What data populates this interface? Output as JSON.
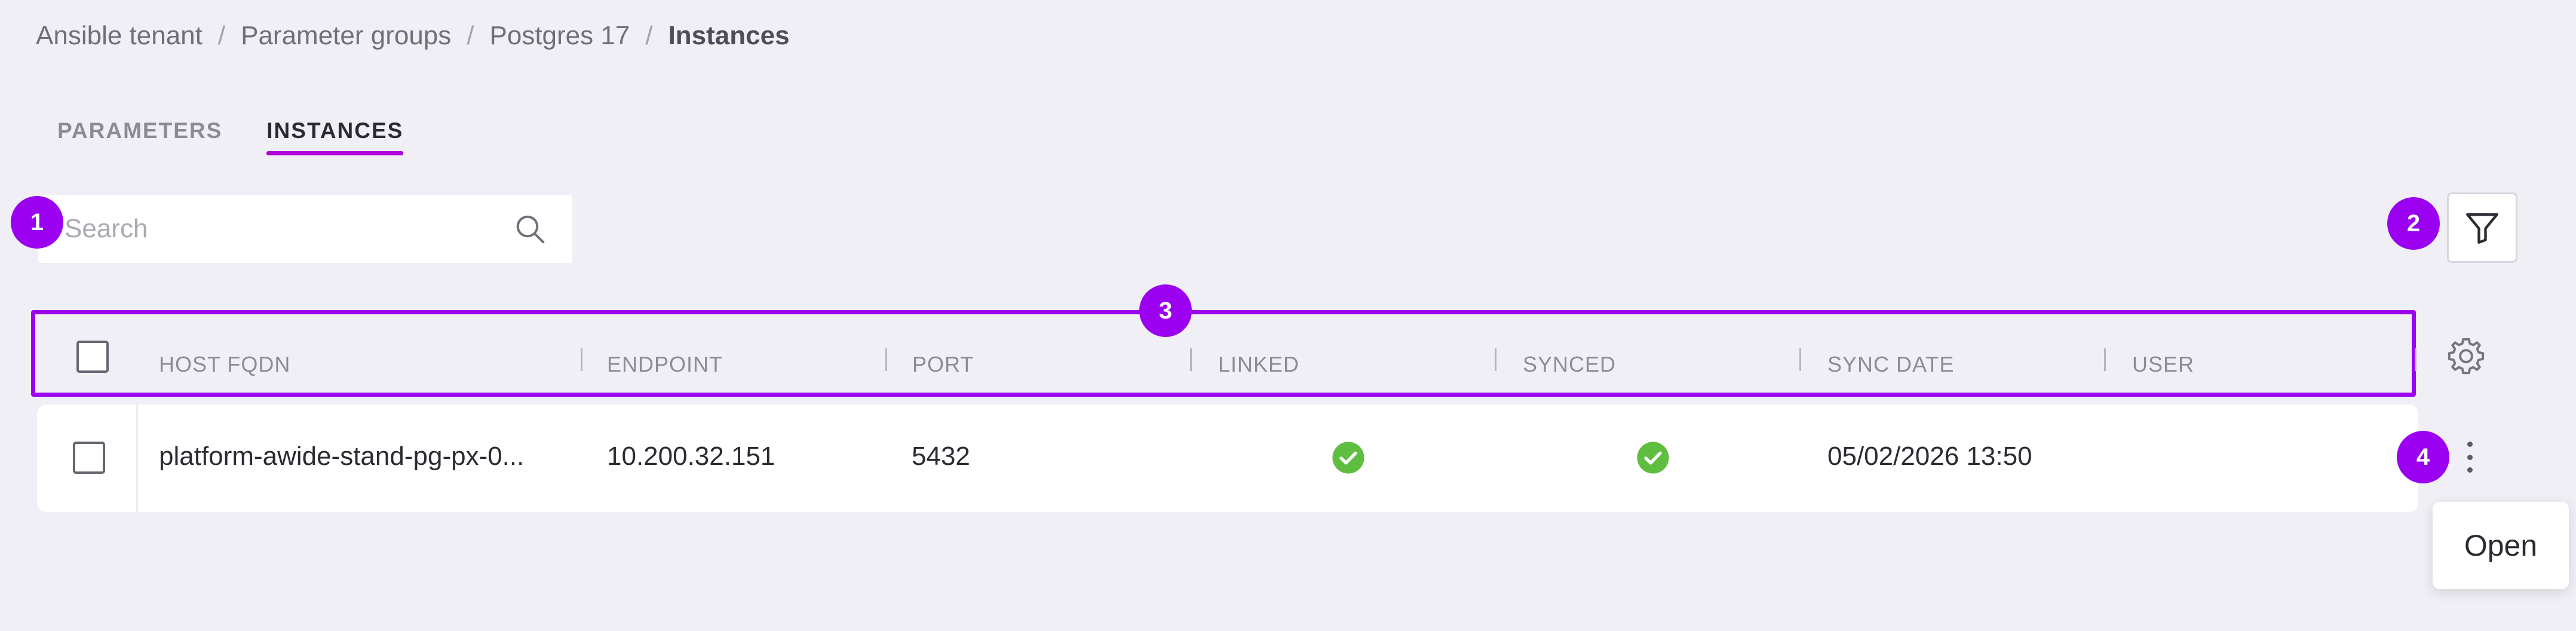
{
  "breadcrumb": {
    "items": [
      "Ansible tenant",
      "Parameter groups",
      "Postgres 17",
      "Instances"
    ],
    "separator": "/"
  },
  "tabs": [
    {
      "label": "PARAMETERS",
      "active": false
    },
    {
      "label": "INSTANCES",
      "active": true
    }
  ],
  "search": {
    "placeholder": "Search",
    "value": "",
    "icon": "search-icon"
  },
  "toolbar": {
    "filter_icon": "filter-icon",
    "settings_icon": "gear-icon"
  },
  "annotations": [
    "1",
    "2",
    "3",
    "4"
  ],
  "table": {
    "columns": [
      "HOST FQDN",
      "ENDPOINT",
      "PORT",
      "LINKED",
      "SYNCED",
      "SYNC DATE",
      "USER"
    ],
    "rows": [
      {
        "host_fqdn": "platform-awide-stand-pg-px-0...",
        "endpoint": "10.200.32.151",
        "port": "5432",
        "linked": true,
        "synced": true,
        "sync_date": "05/02/2026 13:50",
        "user": ""
      }
    ]
  },
  "row_menu": {
    "items": [
      "Open"
    ]
  },
  "colors": {
    "accent": "#9b00f0",
    "tab_underline": "#b000d8",
    "success": "#5fbe3f",
    "background": "#efeff5"
  }
}
